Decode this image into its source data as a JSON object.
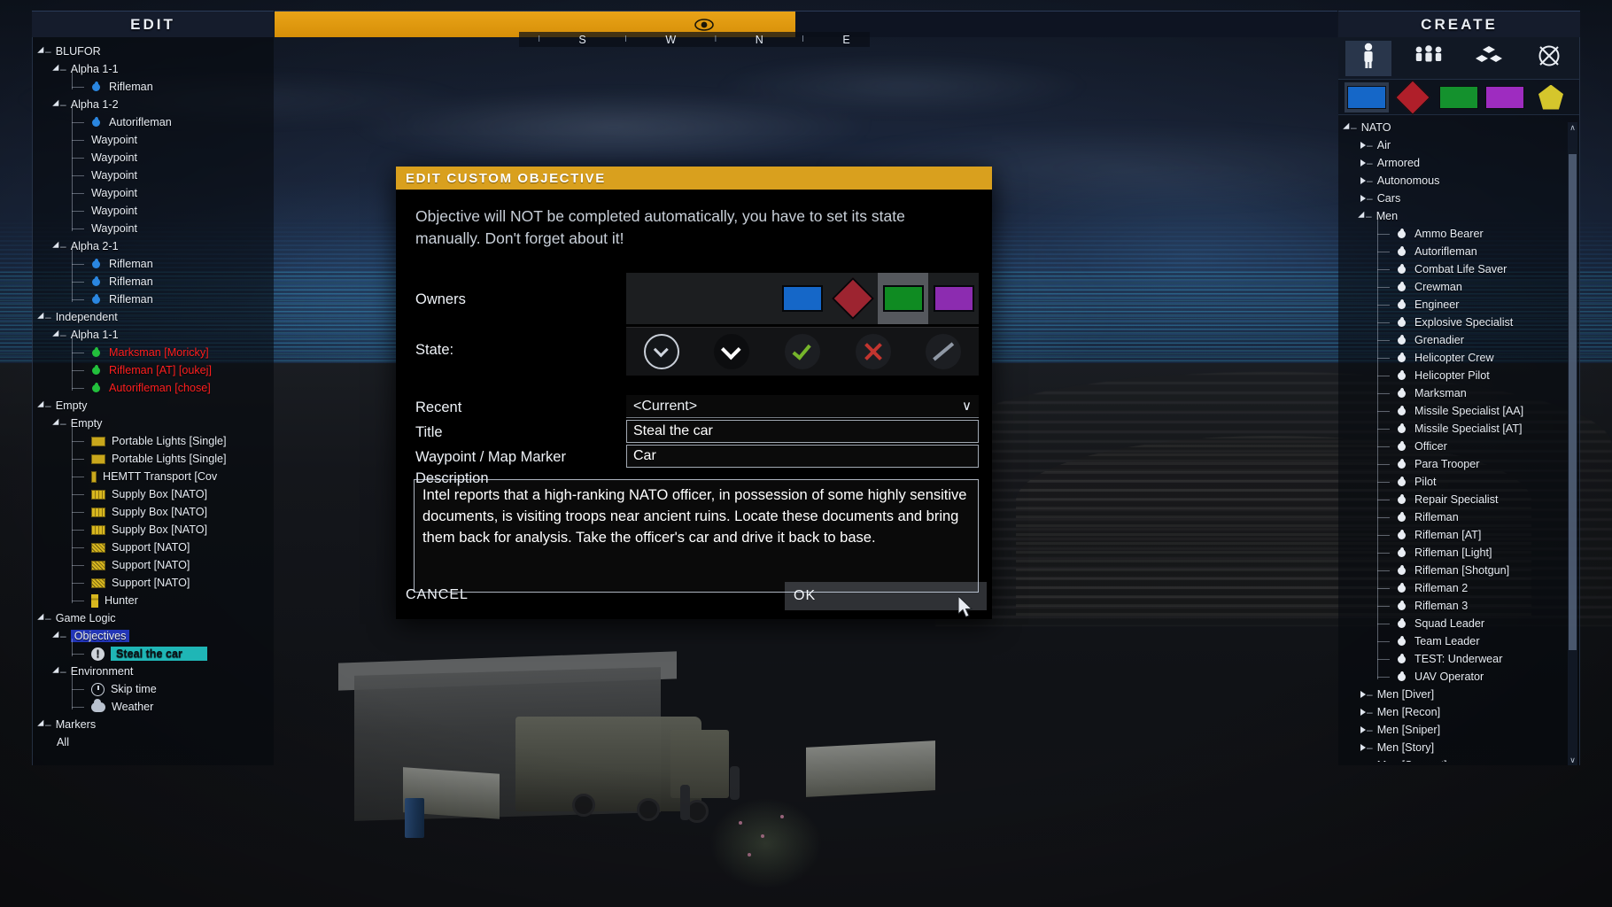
{
  "topbar": {
    "left_title": "EDIT",
    "right_title": "CREATE",
    "eye_icon": "eye-icon",
    "compass": [
      "I",
      "S",
      "I",
      "W",
      "I",
      "N",
      "I",
      "E"
    ]
  },
  "left_panel": {
    "tree": [
      {
        "depth": 0,
        "toggle": "down",
        "label": "BLUFOR",
        "icon": "none"
      },
      {
        "depth": 1,
        "toggle": "down",
        "label": "Alpha 1-1",
        "icon": "none"
      },
      {
        "depth": 2,
        "toggle": "none",
        "label": "Rifleman",
        "icon": "unit-blue"
      },
      {
        "depth": 1,
        "toggle": "down",
        "label": "Alpha 1-2",
        "icon": "none"
      },
      {
        "depth": 2,
        "toggle": "none",
        "label": "Autorifleman",
        "icon": "unit-blue"
      },
      {
        "depth": 2,
        "toggle": "none",
        "label": "Waypoint",
        "icon": "none"
      },
      {
        "depth": 2,
        "toggle": "none",
        "label": "Waypoint",
        "icon": "none"
      },
      {
        "depth": 2,
        "toggle": "none",
        "label": "Waypoint",
        "icon": "none"
      },
      {
        "depth": 2,
        "toggle": "none",
        "label": "Waypoint",
        "icon": "none"
      },
      {
        "depth": 2,
        "toggle": "none",
        "label": "Waypoint",
        "icon": "none"
      },
      {
        "depth": 2,
        "toggle": "none",
        "label": "Waypoint",
        "icon": "none"
      },
      {
        "depth": 1,
        "toggle": "down",
        "label": "Alpha 2-1",
        "icon": "none"
      },
      {
        "depth": 2,
        "toggle": "none",
        "label": "Rifleman",
        "icon": "unit-blue"
      },
      {
        "depth": 2,
        "toggle": "none",
        "label": "Rifleman",
        "icon": "unit-blue"
      },
      {
        "depth": 2,
        "toggle": "none",
        "label": "Rifleman",
        "icon": "unit-blue"
      },
      {
        "depth": 0,
        "toggle": "down",
        "label": "Independent",
        "icon": "none"
      },
      {
        "depth": 1,
        "toggle": "down",
        "label": "Alpha 1-1",
        "icon": "none"
      },
      {
        "depth": 2,
        "toggle": "none",
        "label": "Marksman [Moricky]",
        "icon": "unit-green",
        "color": "red"
      },
      {
        "depth": 2,
        "toggle": "none",
        "label": "Rifleman [AT] [oukej]",
        "icon": "unit-green",
        "color": "red"
      },
      {
        "depth": 2,
        "toggle": "none",
        "label": "Autorifleman [chose]",
        "icon": "unit-green",
        "color": "red"
      },
      {
        "depth": 0,
        "toggle": "down",
        "label": "Empty",
        "icon": "none"
      },
      {
        "depth": 1,
        "toggle": "down",
        "label": "Empty",
        "icon": "none"
      },
      {
        "depth": 2,
        "toggle": "none",
        "label": "Portable Lights [Single]",
        "icon": "box-plain"
      },
      {
        "depth": 2,
        "toggle": "none",
        "label": "Portable Lights [Single]",
        "icon": "box-plain"
      },
      {
        "depth": 2,
        "toggle": "none",
        "label": "HEMTT Transport [Cov",
        "icon": "box-narrow"
      },
      {
        "depth": 2,
        "toggle": "none",
        "label": "Supply Box [NATO]",
        "icon": "box-supply"
      },
      {
        "depth": 2,
        "toggle": "none",
        "label": "Supply Box [NATO]",
        "icon": "box-supply"
      },
      {
        "depth": 2,
        "toggle": "none",
        "label": "Supply Box [NATO]",
        "icon": "box-supply"
      },
      {
        "depth": 2,
        "toggle": "none",
        "label": "Support [NATO]",
        "icon": "box-support"
      },
      {
        "depth": 2,
        "toggle": "none",
        "label": "Support [NATO]",
        "icon": "box-support"
      },
      {
        "depth": 2,
        "toggle": "none",
        "label": "Support [NATO]",
        "icon": "box-support"
      },
      {
        "depth": 2,
        "toggle": "none",
        "label": "Hunter",
        "icon": "box-hunter"
      },
      {
        "depth": 0,
        "toggle": "down",
        "label": "Game Logic",
        "icon": "none"
      },
      {
        "depth": 1,
        "toggle": "down",
        "label": "Objectives",
        "icon": "none",
        "select": "blue"
      },
      {
        "depth": 2,
        "toggle": "none",
        "label": "Steal the car",
        "icon": "objective",
        "select": "cyan"
      },
      {
        "depth": 1,
        "toggle": "down",
        "label": "Environment",
        "icon": "none"
      },
      {
        "depth": 2,
        "toggle": "none",
        "label": "Skip time",
        "icon": "clock"
      },
      {
        "depth": 2,
        "toggle": "none",
        "label": "Weather",
        "icon": "cloud"
      },
      {
        "depth": 0,
        "toggle": "down",
        "label": "Markers",
        "icon": "none"
      },
      {
        "depth": 1,
        "toggle": "none",
        "label": "All",
        "icon": "none"
      }
    ]
  },
  "right_panel": {
    "categories": [
      {
        "name": "units-category",
        "icon": "person-icon",
        "active": true
      },
      {
        "name": "groups-category",
        "icon": "group-icon",
        "active": false
      },
      {
        "name": "objects-category",
        "icon": "cubes-icon",
        "active": false
      },
      {
        "name": "systems-category",
        "icon": "crossed-circle-icon",
        "active": false
      }
    ],
    "sides": [
      {
        "name": "side-blufor",
        "shape": "square",
        "color": "#1567c8",
        "active": true
      },
      {
        "name": "side-opfor",
        "shape": "diamond",
        "color": "#b01f2a",
        "active": false
      },
      {
        "name": "side-independent",
        "shape": "square",
        "color": "#14912d",
        "active": false
      },
      {
        "name": "side-civilian",
        "shape": "square",
        "color": "#9e2cc0",
        "active": false
      },
      {
        "name": "side-empty",
        "shape": "pentagon",
        "color": "#d5c62c",
        "active": false
      }
    ],
    "tree": [
      {
        "depth": 0,
        "toggle": "down",
        "label": "NATO",
        "icon": "none"
      },
      {
        "depth": 1,
        "toggle": "right",
        "label": "Air",
        "icon": "none"
      },
      {
        "depth": 1,
        "toggle": "right",
        "label": "Armored",
        "icon": "none"
      },
      {
        "depth": 1,
        "toggle": "right",
        "label": "Autonomous",
        "icon": "none"
      },
      {
        "depth": 1,
        "toggle": "right",
        "label": "Cars",
        "icon": "none"
      },
      {
        "depth": 1,
        "toggle": "down",
        "label": "Men",
        "icon": "none"
      },
      {
        "depth": 2,
        "toggle": "none",
        "label": "Ammo Bearer",
        "icon": "unit-white"
      },
      {
        "depth": 2,
        "toggle": "none",
        "label": "Autorifleman",
        "icon": "unit-white"
      },
      {
        "depth": 2,
        "toggle": "none",
        "label": "Combat Life Saver",
        "icon": "unit-white"
      },
      {
        "depth": 2,
        "toggle": "none",
        "label": "Crewman",
        "icon": "unit-white"
      },
      {
        "depth": 2,
        "toggle": "none",
        "label": "Engineer",
        "icon": "unit-white"
      },
      {
        "depth": 2,
        "toggle": "none",
        "label": "Explosive Specialist",
        "icon": "unit-white"
      },
      {
        "depth": 2,
        "toggle": "none",
        "label": "Grenadier",
        "icon": "unit-white"
      },
      {
        "depth": 2,
        "toggle": "none",
        "label": "Helicopter Crew",
        "icon": "unit-white"
      },
      {
        "depth": 2,
        "toggle": "none",
        "label": "Helicopter Pilot",
        "icon": "unit-white"
      },
      {
        "depth": 2,
        "toggle": "none",
        "label": "Marksman",
        "icon": "unit-white"
      },
      {
        "depth": 2,
        "toggle": "none",
        "label": "Missile Specialist [AA]",
        "icon": "unit-white"
      },
      {
        "depth": 2,
        "toggle": "none",
        "label": "Missile Specialist [AT]",
        "icon": "unit-white"
      },
      {
        "depth": 2,
        "toggle": "none",
        "label": "Officer",
        "icon": "unit-white"
      },
      {
        "depth": 2,
        "toggle": "none",
        "label": "Para Trooper",
        "icon": "unit-white"
      },
      {
        "depth": 2,
        "toggle": "none",
        "label": "Pilot",
        "icon": "unit-white"
      },
      {
        "depth": 2,
        "toggle": "none",
        "label": "Repair Specialist",
        "icon": "unit-white"
      },
      {
        "depth": 2,
        "toggle": "none",
        "label": "Rifleman",
        "icon": "unit-white"
      },
      {
        "depth": 2,
        "toggle": "none",
        "label": "Rifleman [AT]",
        "icon": "unit-white"
      },
      {
        "depth": 2,
        "toggle": "none",
        "label": "Rifleman [Light]",
        "icon": "unit-white"
      },
      {
        "depth": 2,
        "toggle": "none",
        "label": "Rifleman [Shotgun]",
        "icon": "unit-white"
      },
      {
        "depth": 2,
        "toggle": "none",
        "label": "Rifleman 2",
        "icon": "unit-white"
      },
      {
        "depth": 2,
        "toggle": "none",
        "label": "Rifleman 3",
        "icon": "unit-white"
      },
      {
        "depth": 2,
        "toggle": "none",
        "label": "Squad Leader",
        "icon": "unit-white"
      },
      {
        "depth": 2,
        "toggle": "none",
        "label": "Team Leader",
        "icon": "unit-white"
      },
      {
        "depth": 2,
        "toggle": "none",
        "label": "TEST: Underwear",
        "icon": "unit-white"
      },
      {
        "depth": 2,
        "toggle": "none",
        "label": "UAV Operator",
        "icon": "unit-white"
      },
      {
        "depth": 1,
        "toggle": "right",
        "label": "Men [Diver]",
        "icon": "none"
      },
      {
        "depth": 1,
        "toggle": "right",
        "label": "Men [Recon]",
        "icon": "none"
      },
      {
        "depth": 1,
        "toggle": "right",
        "label": "Men [Sniper]",
        "icon": "none"
      },
      {
        "depth": 1,
        "toggle": "right",
        "label": "Men [Story]",
        "icon": "none"
      },
      {
        "depth": 1,
        "toggle": "right",
        "label": "Men [Support]",
        "icon": "none"
      }
    ]
  },
  "dialog": {
    "title": "EDIT CUSTOM OBJECTIVE",
    "hint": "Objective will NOT be completed automatically, you have to set its state manually. Don't forget about it!",
    "owners_label": "Owners",
    "owners": [
      {
        "name": "owner-none-1",
        "shape": "none",
        "color": "",
        "active": false
      },
      {
        "name": "owner-none-2",
        "shape": "none",
        "color": "",
        "active": false
      },
      {
        "name": "owner-none-3",
        "shape": "none",
        "color": "",
        "active": false
      },
      {
        "name": "owner-blufor",
        "shape": "square",
        "color": "#1567c8",
        "active": false
      },
      {
        "name": "owner-opfor",
        "shape": "diamond",
        "color": "#9d2430",
        "active": false
      },
      {
        "name": "owner-independent",
        "shape": "square",
        "color": "#0f8b22",
        "active": true
      },
      {
        "name": "owner-civilian",
        "shape": "square",
        "color": "#8c2cb0",
        "active": false
      }
    ],
    "state_label": "State:",
    "states": [
      {
        "name": "state-unknown",
        "icon": "clock-circle-icon",
        "active": false
      },
      {
        "name": "state-active",
        "icon": "chevron-down-icon",
        "active": true
      },
      {
        "name": "state-completed",
        "icon": "check-icon",
        "active": false
      },
      {
        "name": "state-failed",
        "icon": "x-icon",
        "active": false
      },
      {
        "name": "state-canceled",
        "icon": "slash-icon",
        "active": false
      }
    ],
    "recent_label": "Recent",
    "recent_value": "<Current>",
    "recent_caret": "∨",
    "title_label": "Title",
    "title_value": "Steal the car",
    "marker_label": "Waypoint / Map Marker",
    "marker_value": "Car",
    "description_label": "Description",
    "description_value": "Intel reports that a high-ranking NATO officer, in possession of some highly sensitive documents, is visiting troops near ancient ruins. Locate these documents and bring them back for analysis. Take the officer's car and drive it back to base.",
    "cancel_label": "CANCEL",
    "ok_label": "OK"
  }
}
